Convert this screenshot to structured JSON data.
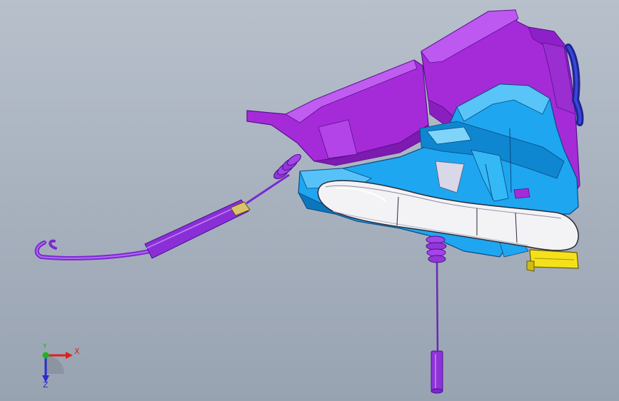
{
  "app": {
    "view": "cad-3d-model-viewport"
  },
  "triad": {
    "x_label": "X",
    "y_label": "Y",
    "z_label": "Z",
    "colors": {
      "x": "#e02020",
      "y": "#1fb41f",
      "z": "#2a2ad0"
    }
  },
  "model": {
    "parts": [
      {
        "name": "lock-housing",
        "color": "#a52bd8"
      },
      {
        "name": "carrier-frame",
        "color": "#1fa6f0"
      },
      {
        "name": "door-handle",
        "color": "#f3f3f6"
      },
      {
        "name": "rod-cable",
        "color": "#8f33d8"
      },
      {
        "name": "bowden-cable",
        "color": "#9a3ce0"
      },
      {
        "name": "clip",
        "color": "#f4e11c"
      },
      {
        "name": "seal",
        "color": "#2730c8"
      }
    ]
  }
}
